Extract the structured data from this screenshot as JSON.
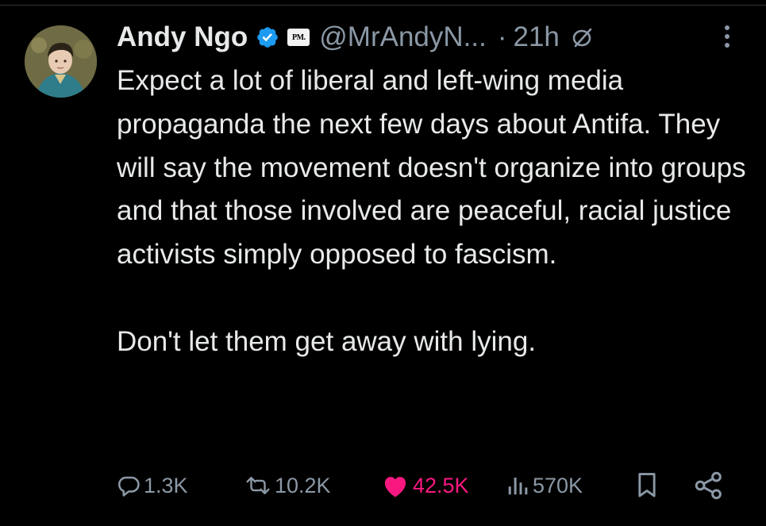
{
  "tweet": {
    "author_name": "Andy Ngo",
    "author_handle": "@MrAndyN...",
    "separator": "·",
    "time_ago": "21h",
    "affiliation_badge": "PM.",
    "paragraphs": [
      "Expect a lot of liberal and left-wing media propaganda the next few days about Antifa. They will say the movement doesn't organize into groups and that those involved are peaceful, racial justice activists simply opposed to fascism.",
      "Don't let them get away with lying."
    ],
    "stats": {
      "replies": "1.3K",
      "reposts": "10.2K",
      "likes": "42.5K",
      "views": "570K"
    }
  },
  "colors": {
    "background": "#000000",
    "text": "#e7e9ea",
    "muted": "#8b98a5",
    "verified": "#1d9bf0",
    "like": "#f91880"
  },
  "icons": [
    "verified-badge-icon",
    "edited-icon",
    "more-icon",
    "reply-icon",
    "repost-icon",
    "heart-icon",
    "views-icon",
    "bookmark-icon",
    "share-icon"
  ]
}
